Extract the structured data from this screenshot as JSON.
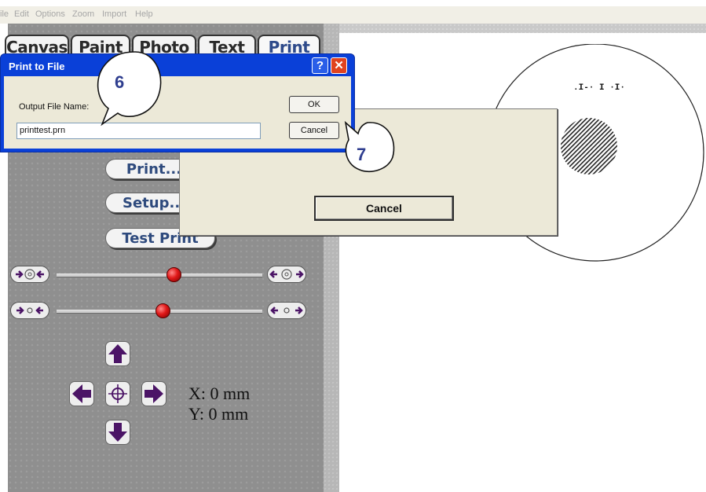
{
  "menu": [
    "ile",
    "Edit",
    "Options",
    "Zoom",
    "Import",
    "Help"
  ],
  "tabs": [
    "Canvas",
    "Paint",
    "Photo",
    "Text",
    "Print"
  ],
  "active_tab": "Print",
  "buttons": {
    "print": "Print...",
    "setup": "Setup...",
    "test_print": "Test Print"
  },
  "coords": {
    "x": "X: 0 mm",
    "y": "Y: 0 mm"
  },
  "print_dialog": {
    "title": "Print to File",
    "help_glyph": "?",
    "close_glyph": "✕",
    "label": "Output File Name:",
    "value": "printtest.prn",
    "ok": "OK",
    "cancel": "Cancel"
  },
  "progress_dialog": {
    "cancel": "Cancel"
  },
  "callouts": [
    "6",
    "7"
  ],
  "disc_text": ".I-· I ·I·",
  "colors": {
    "titlebar": "#0a40d8",
    "accent": "#2e4a8a",
    "knob": "#e01818",
    "arrow": "#4b1466"
  }
}
